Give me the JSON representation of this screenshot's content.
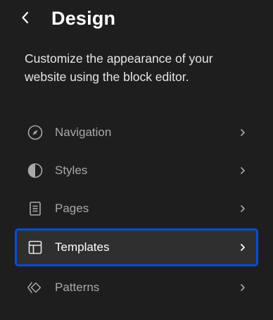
{
  "header": {
    "title": "Design",
    "back_icon": "chevron-left-icon"
  },
  "description": "Customize the appearance of your website using the block editor.",
  "menu": {
    "items": [
      {
        "label": "Navigation",
        "icon": "compass-icon",
        "active": false
      },
      {
        "label": "Styles",
        "icon": "half-circle-icon",
        "active": false
      },
      {
        "label": "Pages",
        "icon": "page-icon",
        "active": false
      },
      {
        "label": "Templates",
        "icon": "layout-icon",
        "active": true
      },
      {
        "label": "Patterns",
        "icon": "symbol-icon",
        "active": false
      }
    ]
  },
  "colors": {
    "background": "#1e1e1e",
    "active_background": "#2f2f2f",
    "highlight_outline": "#0a4bd8",
    "text_muted": "#a8a8a8",
    "text_primary": "#ffffff"
  }
}
